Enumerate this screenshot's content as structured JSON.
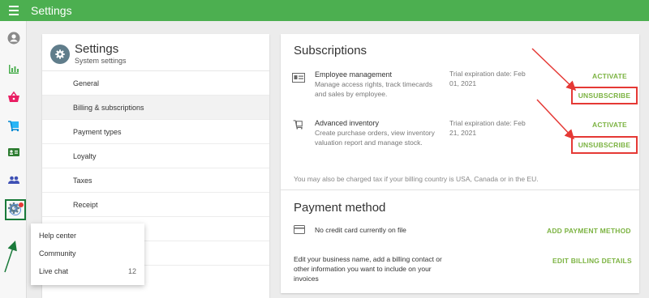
{
  "topbar": {
    "title": "Settings"
  },
  "nav": {
    "icons": [
      "account-icon",
      "reports-icon",
      "basket-icon",
      "items-icon",
      "customer-card-icon",
      "employees-icon",
      "settings-icon",
      "help-icon"
    ]
  },
  "settings_panel": {
    "title": "Settings",
    "subtitle": "System settings",
    "items": [
      {
        "label": "General"
      },
      {
        "label": "Billing & subscriptions"
      },
      {
        "label": "Payment types"
      },
      {
        "label": "Loyalty"
      },
      {
        "label": "Taxes"
      },
      {
        "label": "Receipt"
      }
    ]
  },
  "help_menu": {
    "items": [
      {
        "label": "Help center",
        "count": ""
      },
      {
        "label": "Community",
        "count": ""
      },
      {
        "label": "Live chat",
        "count": "12"
      }
    ]
  },
  "subscriptions": {
    "title": "Subscriptions",
    "items": [
      {
        "name": "Employee management",
        "description": "Manage access rights, track timecards and sales by employee.",
        "trial": "Trial expiration date: Feb 01, 2021",
        "activate_label": "ACTIVATE",
        "unsubscribe_label": "UNSUBSCRIBE"
      },
      {
        "name": "Advanced inventory",
        "description": "Create purchase orders, view inventory valuation report and manage stock.",
        "trial": "Trial expiration date: Feb 21, 2021",
        "activate_label": "ACTIVATE",
        "unsubscribe_label": "UNSUBSCRIBE"
      }
    ],
    "tax_note": "You may also be charged tax if your billing country is USA, Canada or in the EU."
  },
  "payment_method": {
    "title": "Payment method",
    "no_card": "No credit card currently on file",
    "add_label": "ADD PAYMENT METHOD",
    "billing_text": "Edit your business name, add a billing contact or other information you want to include on your invoices",
    "edit_label": "EDIT BILLING DETAILS"
  },
  "colors": {
    "brand": "#4caf50",
    "accent_link": "#7cb342",
    "annotation_red": "#e53935",
    "annotation_green": "#1a7a3a"
  }
}
